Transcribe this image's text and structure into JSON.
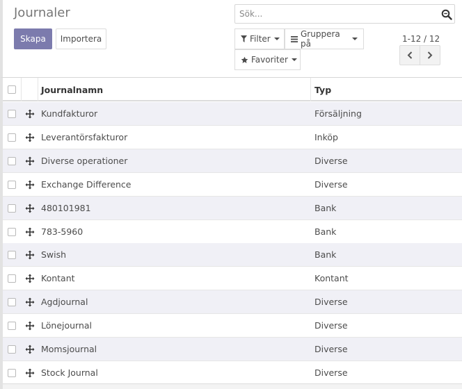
{
  "page": {
    "title": "Journaler"
  },
  "buttons": {
    "create": "Skapa",
    "import": "Importera"
  },
  "search": {
    "placeholder": "Sök..."
  },
  "filters": {
    "filter": "Filter",
    "group_by": "Gruppera på",
    "favorites": "Favoriter"
  },
  "pager": {
    "value": "1-12 / 12"
  },
  "list": {
    "columns": {
      "name": "Journalnamn",
      "type": "Typ"
    },
    "rows": [
      {
        "name": "Kundfakturor",
        "type": "Försäljning"
      },
      {
        "name": "Leverantörsfakturor",
        "type": "Inköp"
      },
      {
        "name": "Diverse operationer",
        "type": "Diverse"
      },
      {
        "name": "Exchange Difference",
        "type": "Diverse"
      },
      {
        "name": "480101981",
        "type": "Bank"
      },
      {
        "name": "783-5960",
        "type": "Bank"
      },
      {
        "name": "Swish",
        "type": "Bank"
      },
      {
        "name": "Kontant",
        "type": "Kontant"
      },
      {
        "name": "Agdjournal",
        "type": "Diverse"
      },
      {
        "name": "Lönejournal",
        "type": "Diverse"
      },
      {
        "name": "Momsjournal",
        "type": "Diverse"
      },
      {
        "name": "Stock Journal",
        "type": "Diverse"
      }
    ]
  },
  "colors": {
    "primary": "#7c7bad",
    "row_alt": "#f0f0f6",
    "border": "#dcdcdc"
  }
}
